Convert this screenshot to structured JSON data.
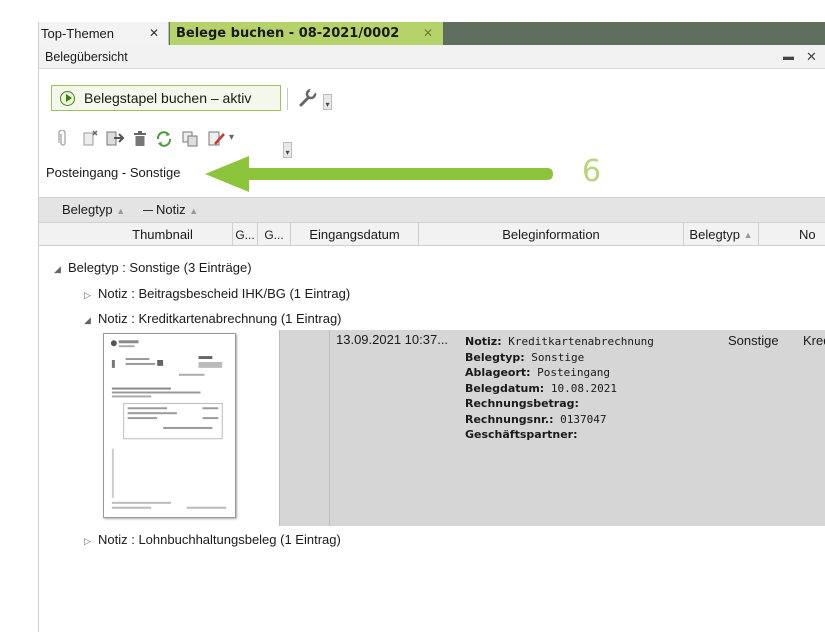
{
  "tabs": [
    {
      "label": "Top-Themen",
      "close": "✕"
    },
    {
      "label": "Belege buchen - 08-2021/0002",
      "close": "✕"
    }
  ],
  "panel": {
    "title": "Belegübersicht",
    "pin": "▬",
    "close": "✕"
  },
  "toolbar": {
    "primary_label": "Belegstapel buchen – aktiv",
    "more": "▾"
  },
  "filter": {
    "label": "Posteingang - Sonstige"
  },
  "annotation": {
    "number": "6",
    "arrow_color": "#8cc43c"
  },
  "groupby": {
    "first": "Belegtyp",
    "second": "Notiz"
  },
  "columns": [
    "Thumbnail",
    "G...",
    "G...",
    "Eingangsdatum",
    "Beleginformation",
    "Belegtyp",
    "No"
  ],
  "tree": {
    "group": "Belegtyp : Sonstige (3 Einträge)",
    "sub1": "Notiz : Beitragsbescheid IHK/BG (1 Eintrag)",
    "sub2": "Notiz : Kreditkartenabrechnung (1 Eintrag)",
    "sub3": "Notiz : Lohnbuchhaltungsbeleg (1 Eintrag)"
  },
  "record": {
    "date": "13.09.2021 10:37...",
    "info": [
      {
        "key": "Notiz:",
        "value": " Kreditkartenabrechnung"
      },
      {
        "key": "Belegtyp:",
        "value": " Sonstige"
      },
      {
        "key": "Ablageort:",
        "value": " Posteingang"
      },
      {
        "key": "Belegdatum:",
        "value": " 10.08.2021"
      },
      {
        "key": "Rechnungsbetrag:",
        "value": ""
      },
      {
        "key": "Rechnungsnr.:",
        "value": " 0137047"
      },
      {
        "key": "Geschäftspartner:",
        "value": ""
      }
    ],
    "type": "Sonstige",
    "note": "Kreditka"
  },
  "colors": {
    "active_tab": "#b6d36b",
    "accent": "#8cc43c"
  }
}
